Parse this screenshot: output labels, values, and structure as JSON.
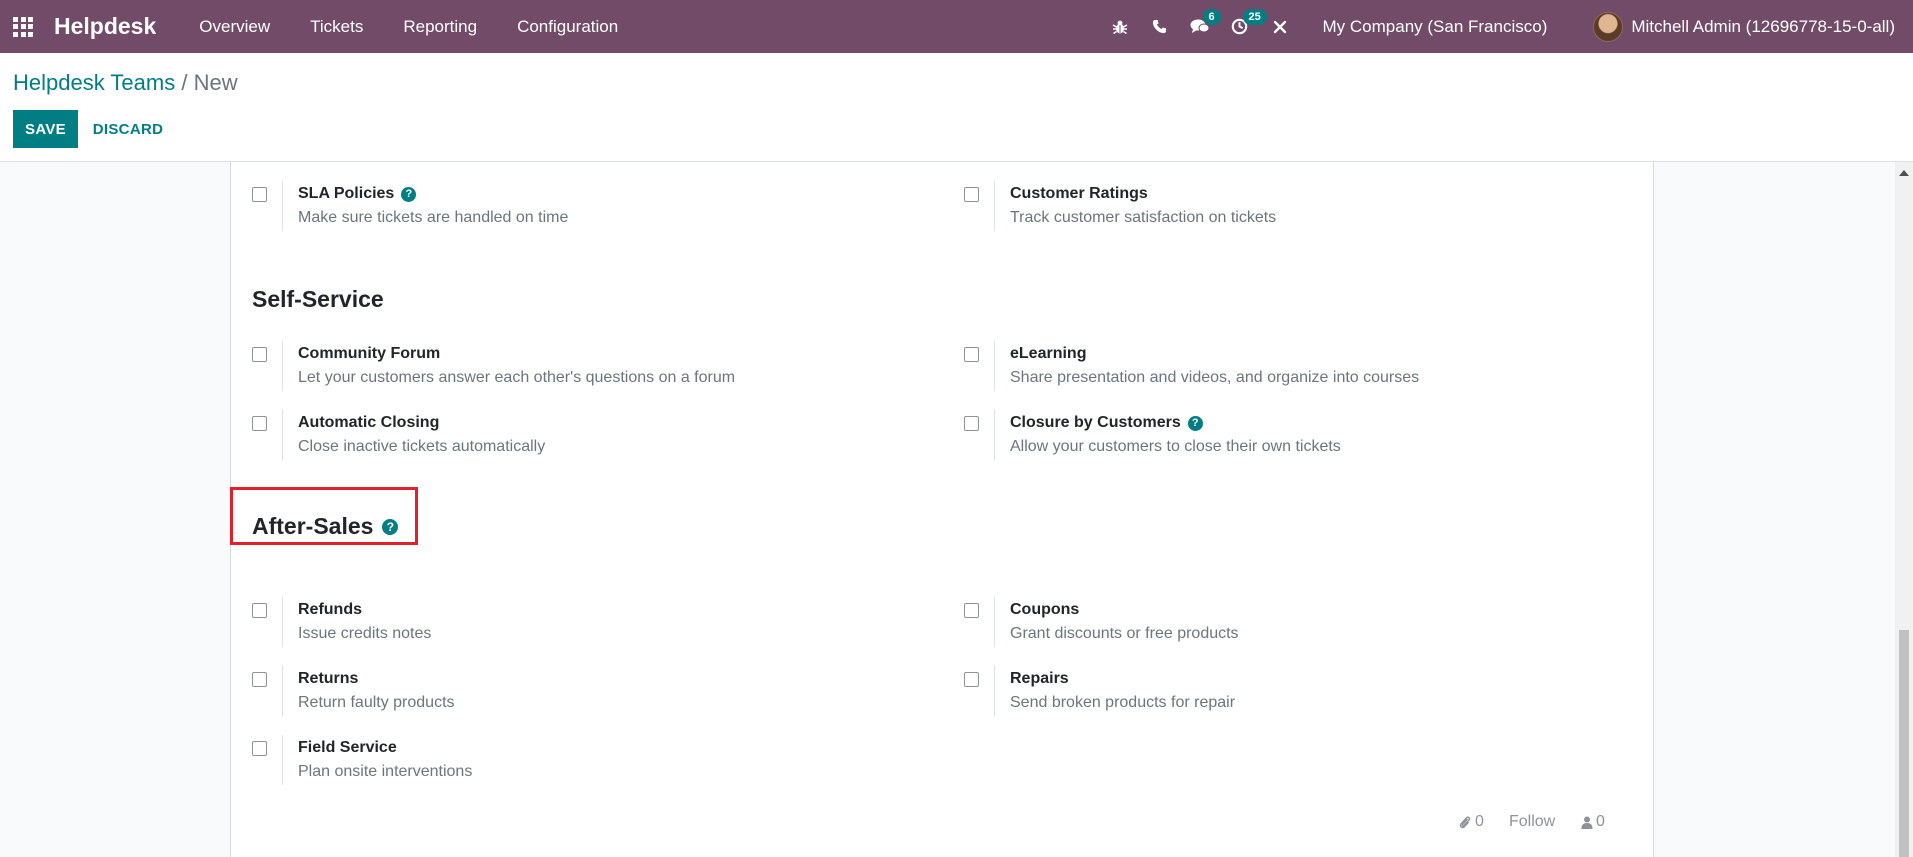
{
  "navbar": {
    "brand": "Helpdesk",
    "menu": [
      "Overview",
      "Tickets",
      "Reporting",
      "Configuration"
    ],
    "messages_count": "6",
    "activities_count": "25",
    "company": "My Company (San Francisco)",
    "user": "Mitchell Admin (12696778-15-0-all)"
  },
  "breadcrumb": {
    "parent": "Helpdesk Teams",
    "separator": "/",
    "current": "New"
  },
  "buttons": {
    "save": "SAVE",
    "discard": "DISCARD"
  },
  "settings_top": {
    "left": {
      "title": "SLA Policies",
      "desc": "Make sure tickets are handled on time"
    },
    "right": {
      "title": "Customer Ratings",
      "desc": "Track customer satisfaction on tickets"
    }
  },
  "self_service": {
    "heading": "Self-Service",
    "items": [
      {
        "title": "Community Forum",
        "desc": "Let your customers answer each other's questions on a forum"
      },
      {
        "title": "eLearning",
        "desc": "Share presentation and videos, and organize into courses"
      },
      {
        "title": "Automatic Closing",
        "desc": "Close inactive tickets automatically"
      },
      {
        "title": "Closure by Customers",
        "desc": "Allow your customers to close their own tickets"
      }
    ]
  },
  "after_sales": {
    "heading": "After-Sales",
    "items": [
      {
        "title": "Refunds",
        "desc": "Issue credits notes"
      },
      {
        "title": "Coupons",
        "desc": "Grant discounts or free products"
      },
      {
        "title": "Returns",
        "desc": "Return faulty products"
      },
      {
        "title": "Repairs",
        "desc": "Send broken products for repair"
      },
      {
        "title": "Field Service",
        "desc": "Plan onsite interventions"
      }
    ]
  },
  "chatter": {
    "attachments": "0",
    "follow": "Follow",
    "followers": "0"
  },
  "colors": {
    "navbar": "#714b67",
    "primary": "#017e84",
    "highlight": "#e0202a"
  }
}
